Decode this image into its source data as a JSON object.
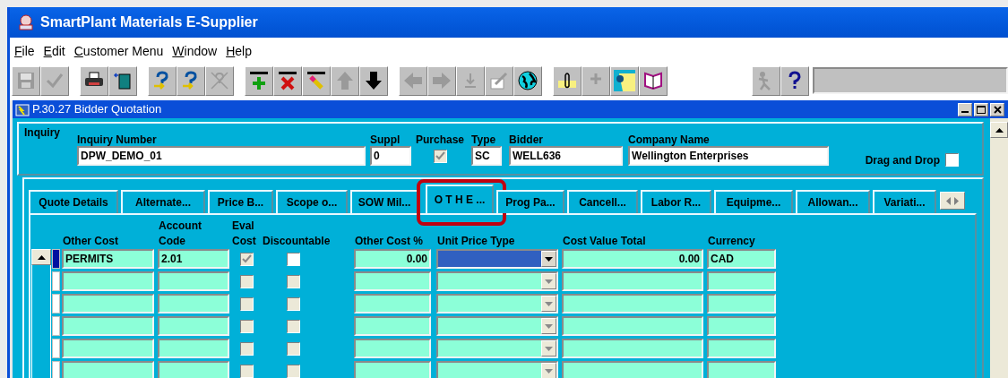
{
  "app_title": "SmartPlant Materials E-Supplier",
  "menu": [
    "File",
    "Edit",
    "Customer Menu",
    "Window",
    "Help"
  ],
  "toolbar": [
    {
      "disabled": true
    },
    {
      "disabled": true
    },
    {
      "disabled": false
    },
    {
      "disabled": false
    },
    {
      "disabled": false
    },
    {
      "disabled": false
    },
    {
      "disabled": true
    },
    {
      "disabled": false
    },
    {
      "disabled": false
    },
    {
      "disabled": false
    },
    {
      "disabled": true
    },
    {
      "disabled": false
    },
    {
      "disabled": true
    },
    {
      "disabled": true
    },
    {
      "disabled": true
    },
    {
      "disabled": true
    },
    {
      "disabled": false
    },
    {
      "disabled": false
    },
    {
      "disabled": true
    },
    {
      "disabled": false
    },
    {
      "disabled": false
    },
    {
      "disabled": true
    },
    {
      "disabled": false
    }
  ],
  "form_window": {
    "title": "P.30.27 Bidder Quotation"
  },
  "inquiry": {
    "label": "Inquiry",
    "fields": [
      {
        "kind": "text",
        "label": "Inquiry Number",
        "value": "DPW_DEMO_01"
      },
      {
        "kind": "text",
        "label": "Suppl",
        "value": "0"
      },
      {
        "kind": "checkbox",
        "label": "Purchase",
        "checked": true,
        "disabled": true
      },
      {
        "kind": "text",
        "label": "Type",
        "value": "SC"
      },
      {
        "kind": "text",
        "label": "Bidder",
        "value": "WELL636"
      },
      {
        "kind": "text",
        "label": "Company Name",
        "value": "Wellington Enterprises"
      },
      {
        "kind": "inline-checkbox",
        "label": "Drag and Drop",
        "checked": false,
        "disabled": false
      }
    ]
  },
  "tabs": [
    {
      "label": "Quote Details",
      "selected": false,
      "highlighted": false
    },
    {
      "label": "Alternate...",
      "selected": false,
      "highlighted": false
    },
    {
      "label": "Price B...",
      "selected": false,
      "highlighted": false
    },
    {
      "label": "Scope o...",
      "selected": false,
      "highlighted": false
    },
    {
      "label": "SOW Mil...",
      "selected": false,
      "highlighted": false
    },
    {
      "label": "O T H E ...",
      "selected": true,
      "highlighted": true
    },
    {
      "label": "Prog Pa...",
      "selected": false,
      "highlighted": false
    },
    {
      "label": "Cancell...",
      "selected": false,
      "highlighted": false
    },
    {
      "label": "Labor R...",
      "selected": false,
      "highlighted": false
    },
    {
      "label": "Equipme...",
      "selected": false,
      "highlighted": false
    },
    {
      "label": "Allowan...",
      "selected": false,
      "highlighted": false
    },
    {
      "label": "Variati...",
      "selected": false,
      "highlighted": false
    }
  ],
  "table": {
    "columns": [
      [
        "Other Cost"
      ],
      [
        "Account",
        "Code"
      ],
      [
        "Eval",
        "Cost"
      ],
      [
        "Discountable"
      ],
      [
        "Other Cost %"
      ],
      [
        "Unit Price Type"
      ],
      [
        "Cost Value Total"
      ],
      [
        "Currency"
      ]
    ],
    "rows": [
      {
        "current": true,
        "other_cost": "PERMITS",
        "account_code": "2.01",
        "eval_cost": {
          "checked": true,
          "disabled": true
        },
        "discountable": {
          "checked": false,
          "disabled": false
        },
        "other_cost_pct": "0.00",
        "unit_price_type": {
          "focused": true,
          "disabled": false
        },
        "cost_value_total": "0.00",
        "currency": "CAD"
      },
      {
        "current": false,
        "eval_cost": {
          "checked": false,
          "disabled": true
        },
        "discountable": {
          "checked": false,
          "disabled": true
        },
        "unit_price_type": {
          "focused": false,
          "disabled": true
        }
      },
      {
        "current": false,
        "eval_cost": {
          "checked": false,
          "disabled": true
        },
        "discountable": {
          "checked": false,
          "disabled": true
        },
        "unit_price_type": {
          "focused": false,
          "disabled": true
        }
      },
      {
        "current": false,
        "eval_cost": {
          "checked": false,
          "disabled": true
        },
        "discountable": {
          "checked": false,
          "disabled": true
        },
        "unit_price_type": {
          "focused": false,
          "disabled": true
        }
      },
      {
        "current": false,
        "eval_cost": {
          "checked": false,
          "disabled": true
        },
        "discountable": {
          "checked": false,
          "disabled": true
        },
        "unit_price_type": {
          "focused": false,
          "disabled": true
        }
      },
      {
        "current": false,
        "eval_cost": {
          "checked": false,
          "disabled": true
        },
        "discountable": {
          "checked": false,
          "disabled": true
        },
        "unit_price_type": {
          "focused": false,
          "disabled": true
        }
      }
    ]
  }
}
